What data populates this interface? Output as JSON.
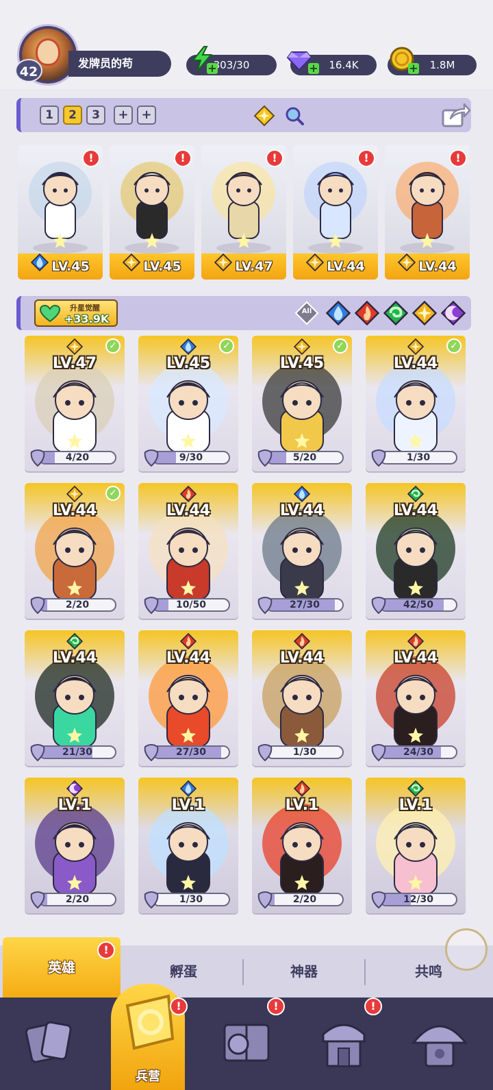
{
  "player": {
    "level": "42",
    "name": "发牌员的苟"
  },
  "resources": {
    "energy": "303/30",
    "gems": "16.4K",
    "coins": "1.8M"
  },
  "team": {
    "tabs": [
      "1",
      "2",
      "3"
    ],
    "active_tab": "2",
    "add_tabs": [
      "+",
      "+"
    ]
  },
  "formation": [
    {
      "level": "LV.45",
      "element": "water",
      "alert": "!"
    },
    {
      "level": "LV.45",
      "element": "light",
      "alert": "!"
    },
    {
      "level": "LV.47",
      "element": "light",
      "alert": "!"
    },
    {
      "level": "LV.44",
      "element": "light",
      "alert": "!"
    },
    {
      "level": "LV.44",
      "element": "light",
      "alert": "!"
    }
  ],
  "awaken": {
    "title": "升星觉醒",
    "value": "+33.9K"
  },
  "filters": [
    "All",
    "water",
    "fire",
    "wind",
    "light",
    "dark"
  ],
  "heroes": [
    {
      "level": "LV.47",
      "element": "light",
      "checked": true,
      "progress": "4/20",
      "fraction": 0.2
    },
    {
      "level": "LV.45",
      "element": "water",
      "checked": true,
      "progress": "9/30",
      "fraction": 0.3
    },
    {
      "level": "LV.45",
      "element": "light",
      "checked": true,
      "progress": "5/20",
      "fraction": 0.25
    },
    {
      "level": "LV.44",
      "element": "light",
      "checked": true,
      "progress": "1/30",
      "fraction": 0.033
    },
    {
      "level": "LV.44",
      "element": "light",
      "checked": true,
      "progress": "2/20",
      "fraction": 0.1
    },
    {
      "level": "LV.44",
      "element": "fire",
      "checked": false,
      "progress": "10/50",
      "fraction": 0.2
    },
    {
      "level": "LV.44",
      "element": "water",
      "checked": false,
      "progress": "27/30",
      "fraction": 0.9
    },
    {
      "level": "LV.44",
      "element": "wind",
      "checked": false,
      "progress": "42/50",
      "fraction": 0.84
    },
    {
      "level": "LV.44",
      "element": "wind",
      "checked": false,
      "progress": "21/30",
      "fraction": 0.7
    },
    {
      "level": "LV.44",
      "element": "fire",
      "checked": false,
      "progress": "27/30",
      "fraction": 0.9
    },
    {
      "level": "LV.44",
      "element": "fire",
      "checked": false,
      "progress": "1/30",
      "fraction": 0.033
    },
    {
      "level": "LV.44",
      "element": "fire",
      "checked": false,
      "progress": "24/30",
      "fraction": 0.8
    },
    {
      "level": "LV.1",
      "element": "dark",
      "checked": false,
      "progress": "2/20",
      "fraction": 0.1
    },
    {
      "level": "LV.1",
      "element": "water",
      "checked": false,
      "progress": "1/30",
      "fraction": 0.033
    },
    {
      "level": "LV.1",
      "element": "fire",
      "checked": false,
      "progress": "2/20",
      "fraction": 0.1
    },
    {
      "level": "LV.1",
      "element": "wind",
      "checked": false,
      "progress": "12/30",
      "fraction": 0.4
    }
  ],
  "subtabs": [
    {
      "label": "英雄",
      "active": true,
      "alert": "!"
    },
    {
      "label": "孵蛋",
      "active": false
    },
    {
      "label": "神器",
      "active": false
    },
    {
      "label": "共鸣",
      "active": false
    }
  ],
  "bottom_nav": [
    {
      "icon": "cards-icon",
      "label": ""
    },
    {
      "icon": "barracks-icon",
      "label": "兵营",
      "active": true,
      "alert": "!"
    },
    {
      "icon": "map-icon",
      "label": "",
      "alert": "!"
    },
    {
      "icon": "shrine-icon",
      "label": "",
      "alert": "!"
    },
    {
      "icon": "mushroom-house-icon",
      "label": ""
    }
  ],
  "colors": {
    "water": "#2f7de0",
    "fire": "#e23a24",
    "wind": "#22b34c",
    "light": "#f2b41e",
    "dark": "#8a3ed6",
    "accent_gold": "#f5c525",
    "panel_purple": "#c9c4e6"
  }
}
